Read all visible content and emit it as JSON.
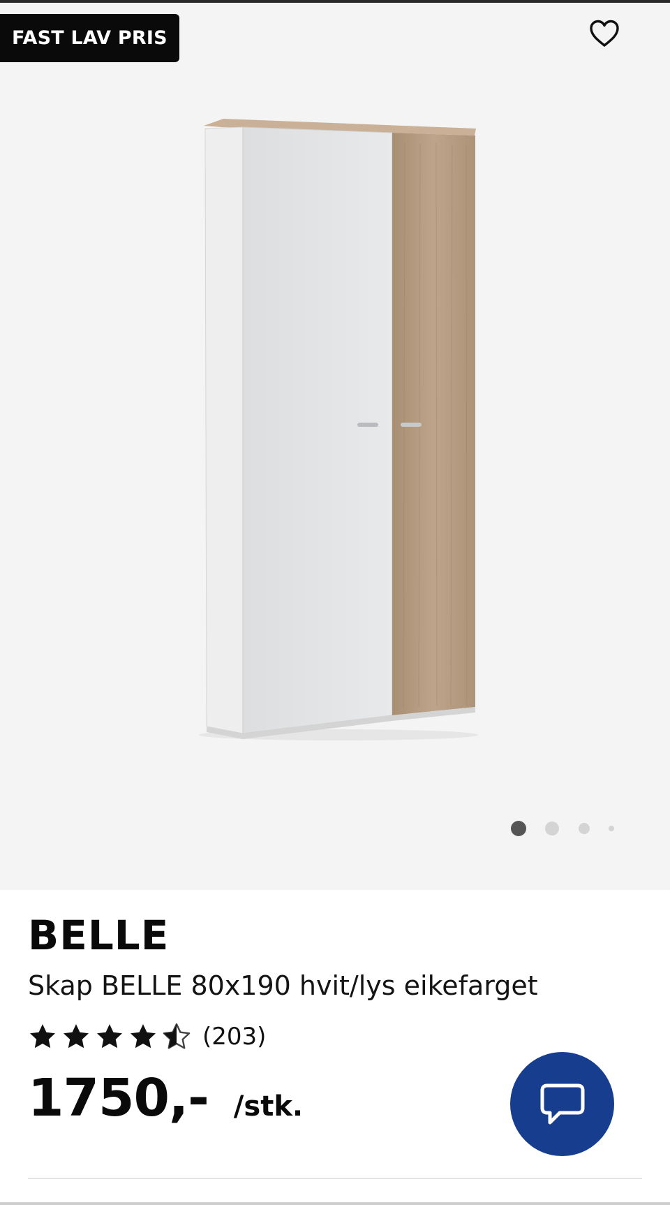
{
  "gallery": {
    "badge": "FAST LAV PRIS",
    "favorite_icon": "heart-outline-icon",
    "image_alt": "Skap BELLE 80x190 hvit/lys eikefarget",
    "dots": {
      "count": 4,
      "active_index": 0
    },
    "colors": {
      "background": "#f4f4f4",
      "cabinet_white": "#e3e5e6",
      "cabinet_oak": "#b49a80"
    }
  },
  "product": {
    "brand": "BELLE",
    "name": "Skap BELLE 80x190 hvit/lys eikefarget",
    "rating": {
      "value": 4.5,
      "max": 5,
      "count_label": "(203)"
    },
    "price": "1750,-",
    "unit": "/stk."
  },
  "chat": {
    "icon": "chat-bubble-icon",
    "color": "#173d8f"
  }
}
